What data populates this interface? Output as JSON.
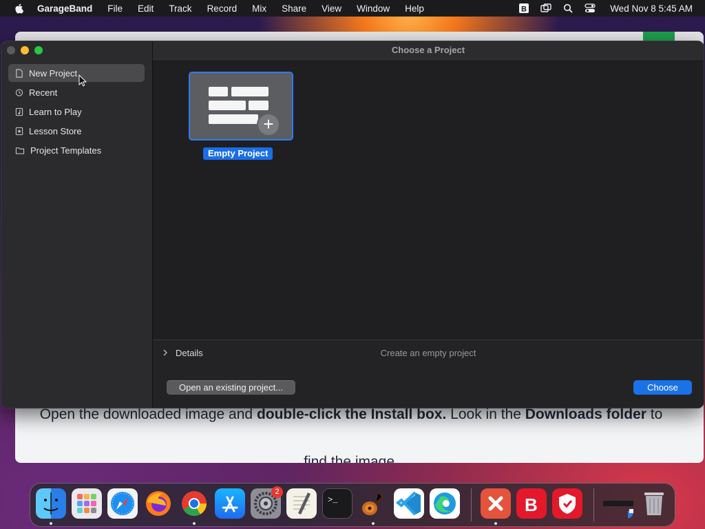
{
  "menubar": {
    "app_name": "GarageBand",
    "items": [
      "File",
      "Edit",
      "Track",
      "Record",
      "Mix",
      "Share",
      "View",
      "Window",
      "Help"
    ],
    "clock": "Wed Nov 8  5:45 AM",
    "status_icons": [
      "bbedit-icon",
      "screen-mirroring-icon",
      "search-icon",
      "control-center-icon"
    ]
  },
  "background_page": {
    "line1_a": "Open the downloaded image and ",
    "line1_b": "double-click the Install box.",
    "line1_c": " Look in the ",
    "line1_d": "Downloads folder",
    "line1_e": " to",
    "line2": "find the image."
  },
  "window": {
    "title": "Choose a Project",
    "sidebar": {
      "items": [
        {
          "label": "New Project",
          "icon": "document-icon",
          "selected": true
        },
        {
          "label": "Recent",
          "icon": "clock-icon",
          "selected": false
        },
        {
          "label": "Learn to Play",
          "icon": "music-note-icon",
          "selected": false
        },
        {
          "label": "Lesson Store",
          "icon": "star-icon",
          "selected": false
        },
        {
          "label": "Project Templates",
          "icon": "folder-icon",
          "selected": false
        }
      ]
    },
    "project_tile": {
      "label": "Empty Project",
      "icon": "empty-project-icon"
    },
    "details": {
      "label": "Details",
      "description": "Create an empty project"
    },
    "buttons": {
      "open_existing": "Open an existing project...",
      "choose": "Choose"
    }
  },
  "dock": {
    "apps": [
      "Finder",
      "Launchpad",
      "Safari",
      "Firefox",
      "Chrome",
      "App Store",
      "System Settings",
      "TextEdit",
      "Terminal",
      "GarageBand",
      "Visual Studio Code",
      "Microsoft Edge",
      "Remote Desktop",
      "Bitdefender",
      "Bitdefender VPN"
    ],
    "settings_badge": "2",
    "colors": {
      "accent": "#1a72e8",
      "selection": "#2f7bf0"
    }
  }
}
